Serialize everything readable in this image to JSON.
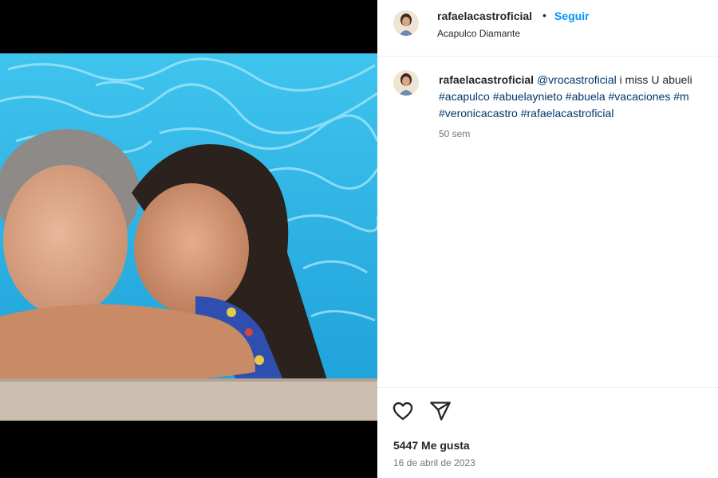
{
  "post": {
    "username": "rafaelacastroficial",
    "follow_label": "Seguir",
    "separator": "•",
    "location": "Acapulco Diamante"
  },
  "caption": {
    "username": "rafaelacastroficial",
    "mention": "@vrocastroficial",
    "text": "i miss U abueli",
    "hashtags_line2": [
      "#acapulco",
      "#abuelaynieto",
      "#abuela",
      "#vacaciones",
      "#m"
    ],
    "hashtags_line3": [
      "#veronicacastro",
      "#rafaelacastroficial"
    ],
    "time_ago": "50 sem"
  },
  "actions": {
    "like_icon": "heart-icon",
    "share_icon": "paper-plane-icon"
  },
  "stats": {
    "likes": "5447 Me gusta",
    "date": "16 de abril de 2023"
  },
  "colors": {
    "link_blue": "#0095f6",
    "hashtag": "#00376b",
    "pool_water": "#2bb3e8"
  }
}
